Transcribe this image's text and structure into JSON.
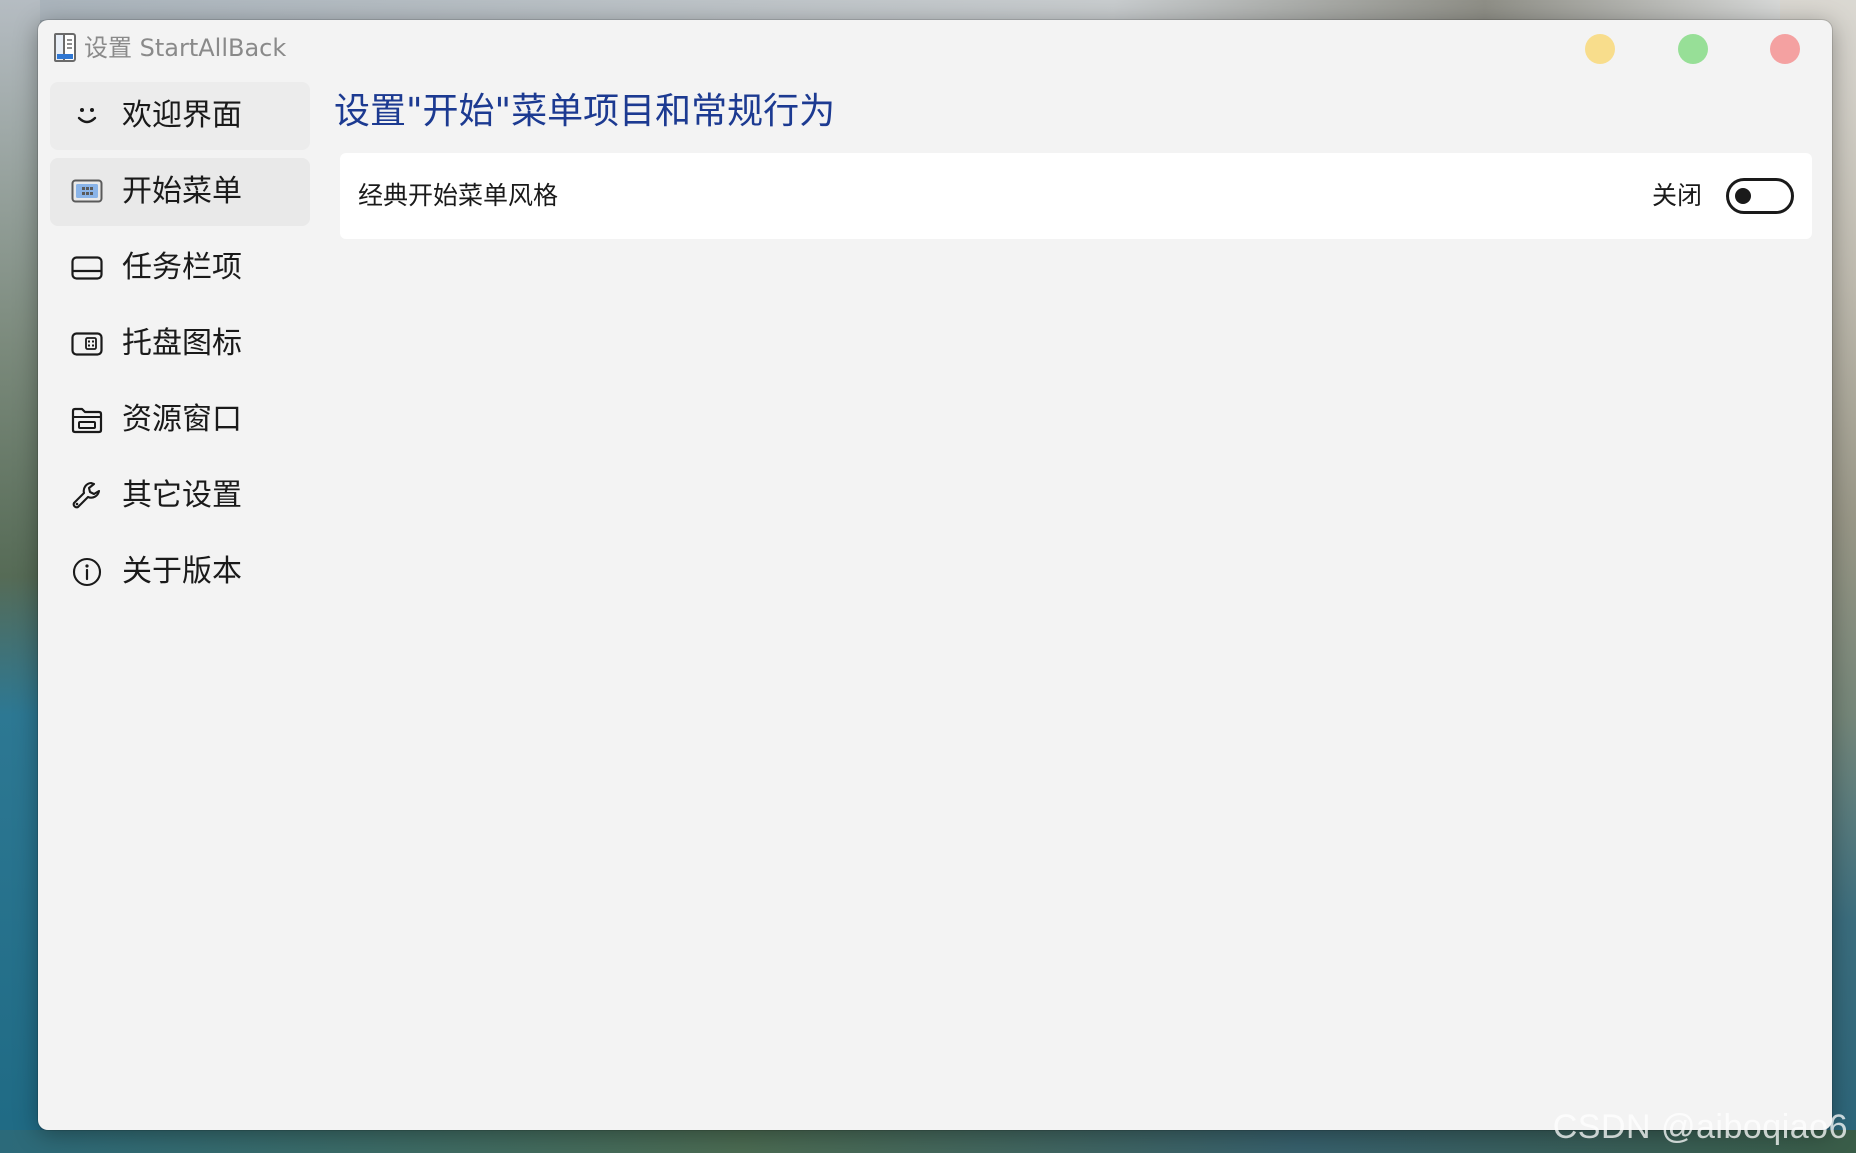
{
  "window": {
    "title": "设置 StartAllBack",
    "controls": {
      "minimize_color": "#f8dd8c",
      "maximize_color": "#97df97",
      "close_color": "#f4a1a1"
    }
  },
  "sidebar": {
    "items": [
      {
        "label": "欢迎界面",
        "icon": "smile-icon",
        "state": "hovered"
      },
      {
        "label": "开始菜单",
        "icon": "start-menu-icon",
        "state": "selected"
      },
      {
        "label": "任务栏项",
        "icon": "taskbar-icon",
        "state": "normal"
      },
      {
        "label": "托盘图标",
        "icon": "tray-icon",
        "state": "normal"
      },
      {
        "label": "资源窗口",
        "icon": "folder-icon",
        "state": "normal"
      },
      {
        "label": "其它设置",
        "icon": "wrench-icon",
        "state": "normal"
      },
      {
        "label": "关于版本",
        "icon": "info-icon",
        "state": "normal"
      }
    ]
  },
  "main": {
    "title": "设置\"开始\"菜单项目和常规行为",
    "title_color": "#1c3a91",
    "settings": [
      {
        "label": "经典开始菜单风格",
        "state_label": "关闭",
        "enabled": false
      }
    ]
  },
  "desktop": {
    "watermark": "CSDN @aiboqiao6"
  }
}
